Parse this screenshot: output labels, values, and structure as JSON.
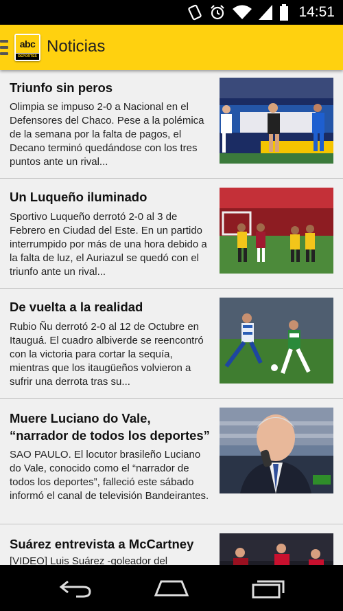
{
  "status_bar": {
    "time": "14:51",
    "icons": [
      "vibrate-icon",
      "alarm-icon",
      "wifi-icon",
      "signal-icon",
      "battery-icon"
    ]
  },
  "app_bar": {
    "title": "Noticias",
    "logo_text": "abc",
    "logo_subtext": "DEPORTES",
    "accent_color": "#ffd10f"
  },
  "articles": [
    {
      "title": "Triunfo sin peros",
      "summary": "Olimpia se impuso 2-0 a Nacional en el Defensores del Chaco. Pese a la polémica de la semana por la falta de pagos, el Decano terminó quedándose con los tres puntos ante un rival..."
    },
    {
      "title": "Un Luqueño iluminado",
      "summary": "Sportivo Luqueño derrotó 2-0 al 3 de Febrero en Ciudad del Este. En un partido interrumpido por más de una hora debido a la falta de luz, el Auriazul se quedó con el triunfo ante un rival..."
    },
    {
      "title": "De vuelta a la realidad",
      "summary": "Rubio Ñu derrotó 2-0 al 12 de Octubre en Itauguá. El cuadro albiverde se reencontró con la victoria para cortar la sequía, mientras que los itaugüeños volvieron a sufrir una derrota tras su..."
    },
    {
      "title": "Muere Luciano do Vale, “narrador de todos los deportes”",
      "summary": "SAO PAULO. El locutor brasileño Luciano do Vale,  conocido como el “narrador de todos los deportes”, falleció este sábado informó el canal de televisión Bandeirantes."
    },
    {
      "title": "Suárez entrevista a McCartney",
      "summary": "[VIDEO] Luis Suárez -goleador del"
    }
  ],
  "nav_bar": {
    "buttons": [
      "back-icon",
      "home-icon",
      "recents-icon"
    ]
  }
}
